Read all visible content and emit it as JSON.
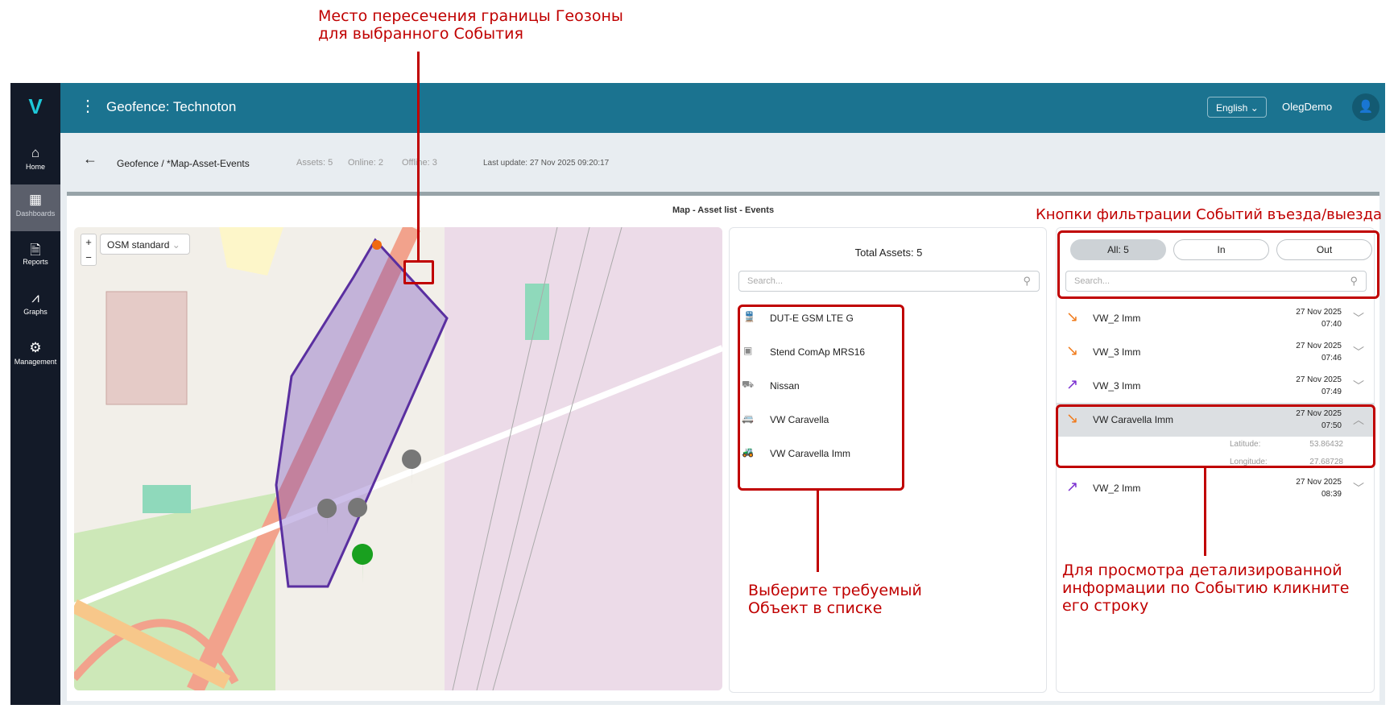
{
  "sidebar": {
    "items": [
      {
        "label": "Home",
        "icon": "home-icon"
      },
      {
        "label": "Dashboards",
        "icon": "dashboard-icon"
      },
      {
        "label": "Reports",
        "icon": "report-icon"
      },
      {
        "label": "Graphs",
        "icon": "graph-icon"
      },
      {
        "label": "Management",
        "icon": "gear-icon"
      }
    ]
  },
  "header": {
    "title": "Geofence: Technoton",
    "language": "English",
    "user": "OlegDemo"
  },
  "subbar": {
    "breadcrumb": "Geofence / *Map-Asset-Events",
    "assets": "Assets: 5",
    "online": "Online: 2",
    "offline": "Offline: 3",
    "last_update": "Last update: 27 Nov 2025 09:20:17"
  },
  "dashboard": {
    "title": "Map - Asset list - Events"
  },
  "map": {
    "zoom_in": "+",
    "zoom_out": "−",
    "layer": "OSM standard"
  },
  "assets": {
    "total": "Total Assets: 5",
    "search_placeholder": "Search...",
    "items": [
      {
        "name": "DUT-E GSM LTE G",
        "icon": "train-icon"
      },
      {
        "name": "Stend ComAp MRS16",
        "icon": "stand-icon"
      },
      {
        "name": "Nissan",
        "icon": "mixer-truck-icon"
      },
      {
        "name": "VW Caravella",
        "icon": "van-icon"
      },
      {
        "name": "VW Caravella Imm",
        "icon": "tractor-icon"
      }
    ]
  },
  "events": {
    "filters": {
      "all": "All: 5",
      "in": "In",
      "out": "Out"
    },
    "search_placeholder": "Search...",
    "items": [
      {
        "name": "VW_2 Imm",
        "date": "27 Nov 2025",
        "time": "07:40",
        "dir": "out"
      },
      {
        "name": "VW_3 Imm",
        "date": "27 Nov 2025",
        "time": "07:46",
        "dir": "out"
      },
      {
        "name": "VW_3 Imm",
        "date": "27 Nov 2025",
        "time": "07:49",
        "dir": "in"
      },
      {
        "name": "VW Caravella Imm",
        "date": "27 Nov 2025",
        "time": "07:50",
        "dir": "out"
      },
      {
        "name": "VW_2 Imm",
        "date": "27 Nov 2025",
        "time": "08:39",
        "dir": "in"
      }
    ],
    "details": {
      "lat_label": "Latitude:",
      "lat": "53.86432",
      "lon_label": "Longitude:",
      "lon": "27.68728"
    }
  },
  "colors": {
    "in": "#7a2fd0",
    "out": "#f07a1a",
    "header": "#1b7390",
    "annotation": "#c00000"
  },
  "annotations": {
    "intersection": [
      "Место пересечения границы Геозоны",
      "для выбранного События"
    ],
    "filters": "Кнопки фильтрации Событий въезда/выезда",
    "select": [
      "Выберите требуемый",
      "Объект в списке"
    ],
    "details": [
      "Для просмотра детализированной",
      "информации по Событию кликните",
      "его строку"
    ]
  }
}
